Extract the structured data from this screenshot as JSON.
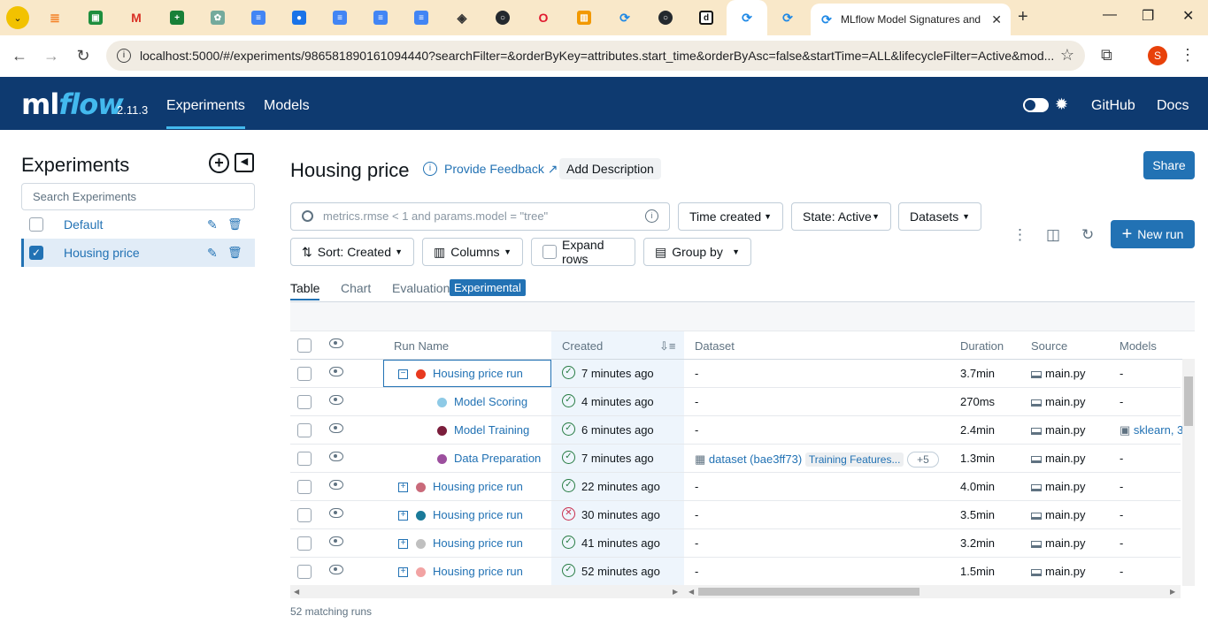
{
  "browser": {
    "active_tab_title": "MLflow Model Signatures and",
    "url": "localhost:5000/#/experiments/986581890161094440?searchFilter=&orderByKey=attributes.start_time&orderByAsc=false&startTime=ALL&lifecycleFilter=Active&mod...",
    "profile_initial": "S",
    "tab_icons": [
      "chevron-down-icon",
      "stackoverflow-icon",
      "classroom-icon",
      "gmail-icon",
      "sheets-icon",
      "chatgpt-icon",
      "docs-icon",
      "contacts-icon",
      "docs-icon",
      "docs-icon",
      "docs-icon",
      "graduation-icon",
      "github-icon",
      "opera-icon",
      "dashboard-icon",
      "sync-icon",
      "github-icon",
      "d-icon",
      "sync-icon",
      "sync-icon"
    ]
  },
  "header": {
    "logo_ml": "ml",
    "logo_flow": "flow",
    "version": "2.11.3",
    "nav": [
      "Experiments",
      "Models"
    ],
    "right_links": [
      "GitHub",
      "Docs"
    ]
  },
  "sidebar": {
    "title": "Experiments",
    "search_placeholder": "Search Experiments",
    "items": [
      {
        "label": "Default",
        "checked": false
      },
      {
        "label": "Housing price",
        "checked": true
      }
    ]
  },
  "main": {
    "title": "Housing price",
    "feedback": "Provide Feedback",
    "add_description": "Add Description",
    "share": "Share",
    "search_placeholder": "metrics.rmse < 1 and params.model = \"tree\"",
    "filters": {
      "time_created": "Time created",
      "state": "State: Active",
      "datasets": "Datasets",
      "sort": "Sort: Created",
      "columns": "Columns",
      "expand_rows": "Expand rows",
      "group_by": "Group by"
    },
    "new_run": "New run",
    "tabs": [
      "Table",
      "Chart",
      "Evaluation"
    ],
    "experimental_badge": "Experimental",
    "columns": [
      "Run Name",
      "Created",
      "Dataset",
      "Duration",
      "Source",
      "Models"
    ],
    "rows": [
      {
        "name": "Housing price run",
        "created": "7 minutes ago",
        "status": "ok",
        "dataset": "-",
        "duration": "3.7min",
        "source": "main.py",
        "models": "-",
        "color": "#e8391f",
        "expander": "minus",
        "indent": 0
      },
      {
        "name": "Model Scoring",
        "created": "4 minutes ago",
        "status": "ok",
        "dataset": "-",
        "duration": "270ms",
        "source": "main.py",
        "models": "-",
        "color": "#8ecae6",
        "expander": "",
        "indent": 1
      },
      {
        "name": "Model Training",
        "created": "6 minutes ago",
        "status": "ok",
        "dataset": "-",
        "duration": "2.4min",
        "source": "main.py",
        "models": "sklearn, 3",
        "color": "#7b1e3c",
        "expander": "",
        "indent": 1
      },
      {
        "name": "Data Preparation",
        "created": "7 minutes ago",
        "status": "ok",
        "dataset": "dataset (bae3ff73)",
        "dataset_tag": "Training Features...",
        "dataset_more": "+5",
        "duration": "1.3min",
        "source": "main.py",
        "models": "-",
        "color": "#9c4f9e",
        "expander": "",
        "indent": 1
      },
      {
        "name": "Housing price run",
        "created": "22 minutes ago",
        "status": "ok",
        "dataset": "-",
        "duration": "4.0min",
        "source": "main.py",
        "models": "-",
        "color": "#c96a7a",
        "expander": "plus",
        "indent": 0
      },
      {
        "name": "Housing price run",
        "created": "30 minutes ago",
        "status": "fail",
        "dataset": "-",
        "duration": "3.5min",
        "source": "main.py",
        "models": "-",
        "color": "#1a7a99",
        "expander": "plus",
        "indent": 0
      },
      {
        "name": "Housing price run",
        "created": "41 minutes ago",
        "status": "ok",
        "dataset": "-",
        "duration": "3.2min",
        "source": "main.py",
        "models": "-",
        "color": "#c0c0c0",
        "expander": "plus",
        "indent": 0
      },
      {
        "name": "Housing price run",
        "created": "52 minutes ago",
        "status": "ok",
        "dataset": "-",
        "duration": "1.5min",
        "source": "main.py",
        "models": "-",
        "color": "#f2a3a3",
        "expander": "plus",
        "indent": 0
      }
    ],
    "footer": "52 matching runs"
  }
}
